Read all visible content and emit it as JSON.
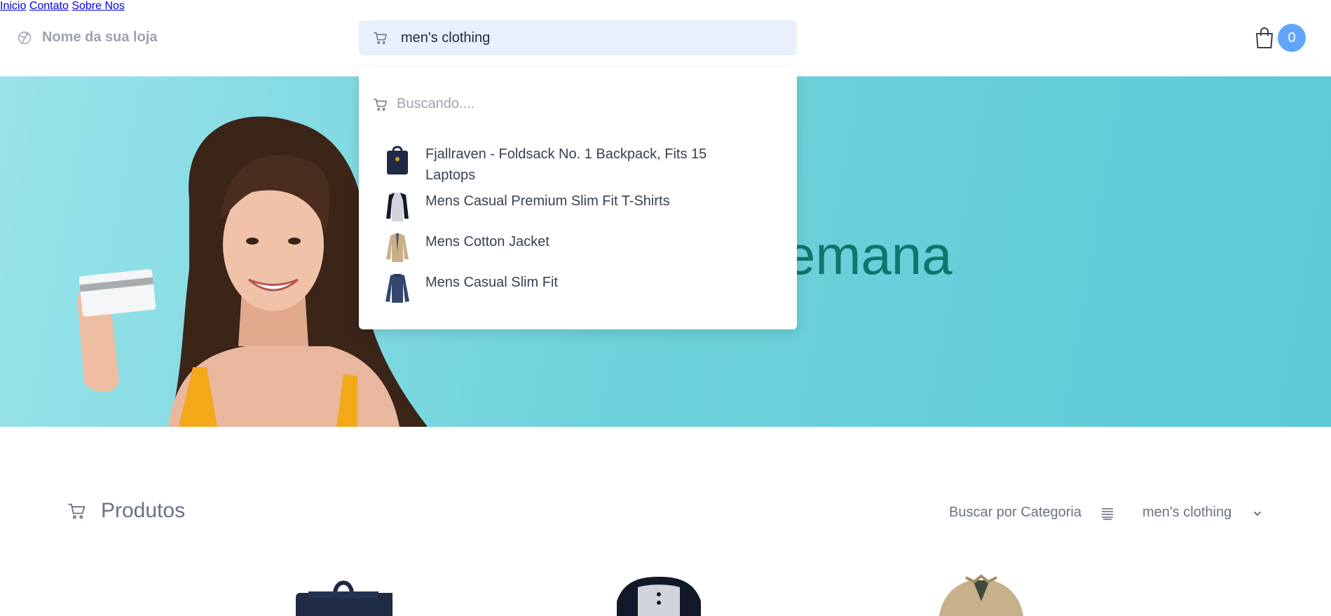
{
  "header": {
    "brand_name": "Nome da sua loja",
    "search_value": "men's clothing",
    "nav": [
      "Inicio",
      "Contato",
      "Sobre Nos"
    ],
    "cart_count": "0"
  },
  "hero": {
    "title_fragment": "emana"
  },
  "dropdown": {
    "status": "Buscando....",
    "items": [
      "Fjallraven - Foldsack No. 1 Backpack, Fits 15 Laptops",
      "Mens Casual Premium Slim Fit T-Shirts",
      "Mens Cotton Jacket",
      "Mens Casual Slim Fit"
    ]
  },
  "products": {
    "title": "Produtos",
    "filter_label": "Buscar por Categoria",
    "category_selected": "men's clothing"
  },
  "colors": {
    "accent": "#60a5fa",
    "hero_text": "#0f766e",
    "hero_bg": "#6fd3dc",
    "search_bg": "#e8f0fb"
  }
}
